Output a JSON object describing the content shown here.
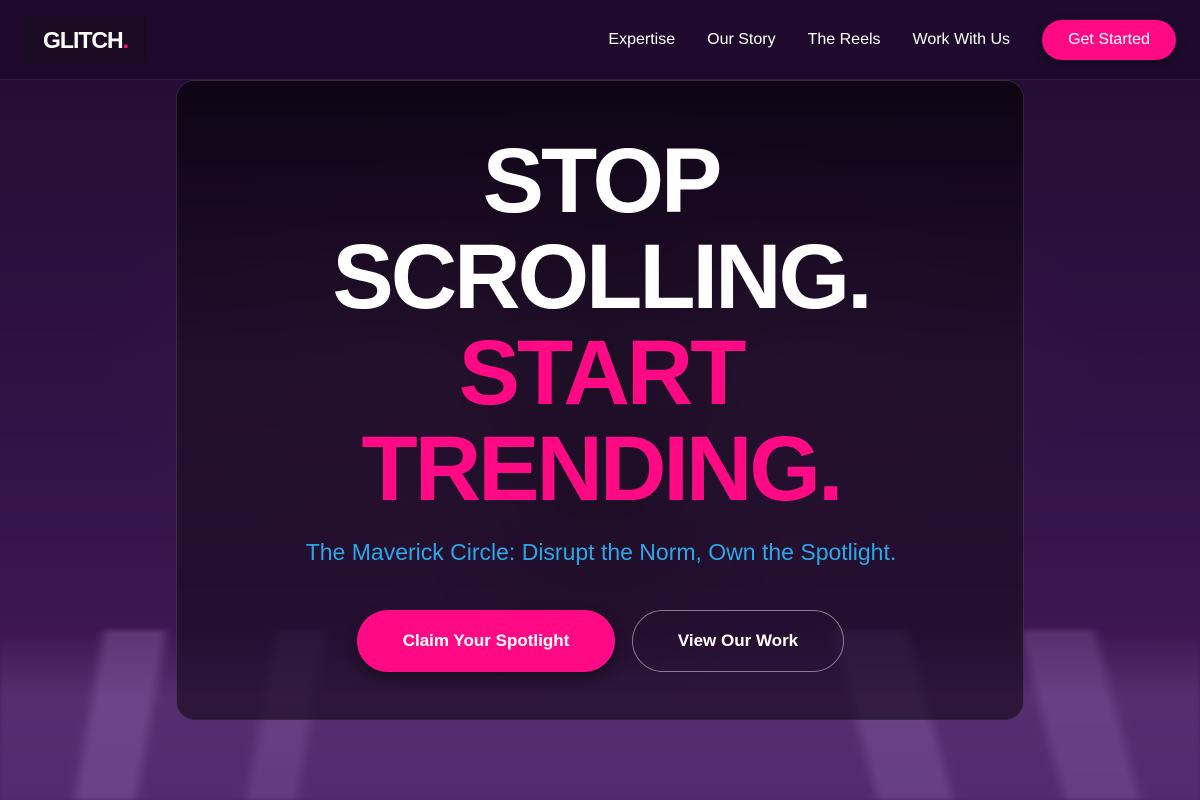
{
  "header": {
    "logo_text": "GLITCH",
    "logo_dot": ".",
    "nav": [
      "Expertise",
      "Our Story",
      "The Reels",
      "Work With Us"
    ],
    "cta_label": "Get Started"
  },
  "hero": {
    "line1": "STOP",
    "line2": "SCROLLING.",
    "line3": "START",
    "line4": "TRENDING.",
    "subtitle": "The Maverick Circle: Disrupt the Norm, Own the Spotlight.",
    "primary_button": "Claim Your Spotlight",
    "secondary_button": "View Our Work"
  },
  "colors": {
    "accent": "#ff0a84",
    "subtitle": "#2ba7e8",
    "background": "#2d1040"
  }
}
